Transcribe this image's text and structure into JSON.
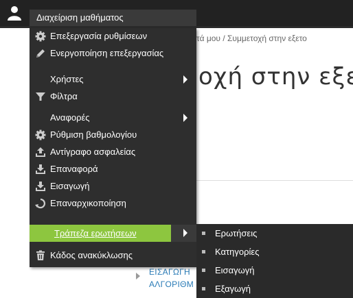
{
  "topbar": {
    "course_admin_label": "Διαχείριση μαθήματος"
  },
  "page": {
    "breadcrumb": "τά μου / Συμμετοχή στην εξετο",
    "title": "οχή στην εξετ",
    "links": [
      "ΕΙΣΑΓΩΓΗ",
      "ΑΛΓΟΡΙΘΜ"
    ]
  },
  "menu": {
    "items": [
      {
        "label": "Επεξεργασία ρυθμίσεων",
        "icon": "gear-icon"
      },
      {
        "label": "Ενεργοποίηση επεξεργασίας",
        "icon": "pencil-icon"
      },
      {
        "label": "Χρήστες",
        "icon": "",
        "submenu": true
      },
      {
        "label": "Φίλτρα",
        "icon": "filter-icon"
      },
      {
        "label": "Αναφορές",
        "icon": "",
        "submenu": true
      },
      {
        "label": "Ρύθμιση βαθμολογίου",
        "icon": "gear-icon"
      },
      {
        "label": "Αντίγραφο ασφαλείας",
        "icon": "upload-icon"
      },
      {
        "label": "Επαναφορά",
        "icon": "download-icon"
      },
      {
        "label": "Εισαγωγή",
        "icon": "download-icon"
      },
      {
        "label": "Επαναρχικοποίηση",
        "icon": "refresh-icon"
      },
      {
        "label": "Τράπεζα ερωτήσεων",
        "icon": "",
        "submenu": true,
        "active": true
      },
      {
        "label": "Κάδος ανακύκλωσης",
        "icon": "trash-icon"
      }
    ]
  },
  "submenu": {
    "items": [
      "Ερωτήσεις",
      "Κατηγορίες",
      "Εισαγωγή",
      "Εξαγωγή"
    ]
  },
  "colors": {
    "topbar": "#222222",
    "menu_bg": "#2e2e2e",
    "active_bg": "#8dc63f",
    "link": "#2a7bb6"
  }
}
